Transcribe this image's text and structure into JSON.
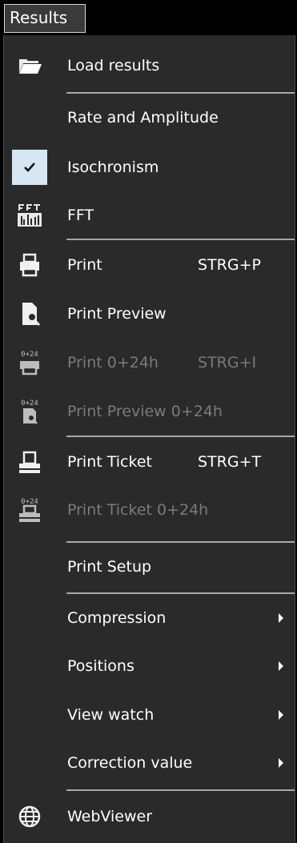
{
  "menu": {
    "title": "Results"
  },
  "items": {
    "load_results": {
      "label": "Load results",
      "icon": "folder-open-icon"
    },
    "rate_amplitude": {
      "label": "Rate and Amplitude"
    },
    "isochronism": {
      "label": "Isochronism",
      "checked": true,
      "icon": "checkmark-icon"
    },
    "fft": {
      "label": "FFT",
      "icon": "fft-icon"
    },
    "print": {
      "label": "Print",
      "shortcut": "STRG+P",
      "icon": "printer-icon"
    },
    "print_preview": {
      "label": "Print Preview",
      "icon": "print-preview-icon"
    },
    "print_0_24h": {
      "label": "Print 0+24h",
      "shortcut": "STRG+I",
      "disabled": true,
      "icon": "printer-0-24-icon",
      "icon_text": "0+24"
    },
    "print_preview_0_24h": {
      "label": "Print Preview 0+24h",
      "disabled": true,
      "icon": "print-preview-0-24-icon",
      "icon_text": "0+24"
    },
    "print_ticket": {
      "label": "Print Ticket",
      "shortcut": "STRG+T",
      "icon": "ticket-printer-icon"
    },
    "print_ticket_0_24h": {
      "label": "Print Ticket 0+24h",
      "disabled": true,
      "icon": "ticket-printer-0-24-icon",
      "icon_text": "0+24"
    },
    "print_setup": {
      "label": "Print Setup"
    },
    "compression": {
      "label": "Compression",
      "submenu": true
    },
    "positions": {
      "label": "Positions",
      "submenu": true
    },
    "view_watch": {
      "label": "View watch",
      "submenu": true
    },
    "correction_value": {
      "label": "Correction value",
      "submenu": true
    },
    "webviewer": {
      "label": "WebViewer",
      "icon": "globe-icon"
    }
  },
  "colors": {
    "menu_bg": "#2a2a2a",
    "text": "#ffffff",
    "disabled_text": "#7a7a7a",
    "separator": "#a8a8a8",
    "checkbox_bg": "#d6e6f2"
  }
}
